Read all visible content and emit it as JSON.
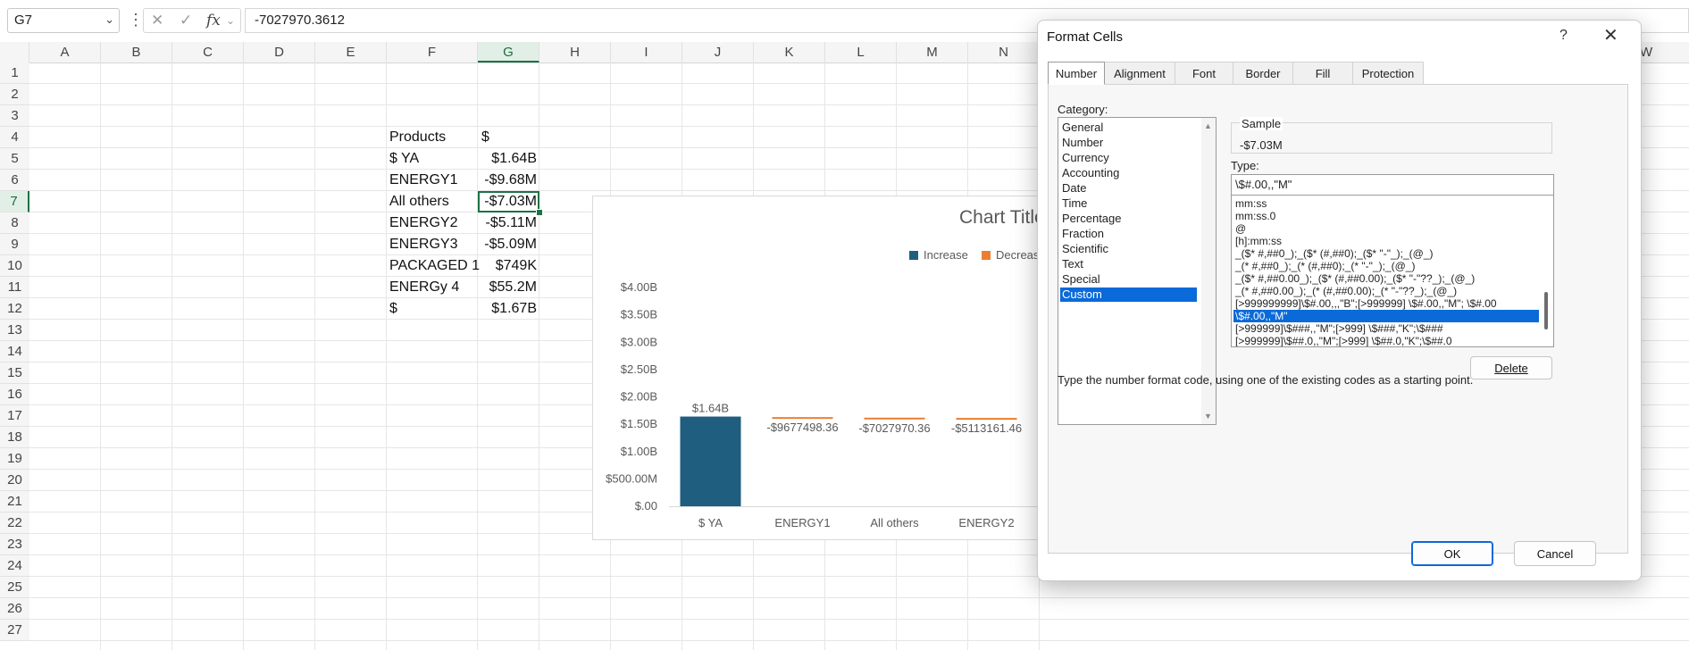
{
  "formula_bar": {
    "name_box": "G7",
    "formula": "-7027970.3612"
  },
  "sheet": {
    "columns": [
      "A",
      "B",
      "C",
      "D",
      "E",
      "F",
      "G",
      "H",
      "I",
      "J",
      "K",
      "L",
      "M",
      "N"
    ],
    "right_column": "W",
    "rows": [
      "1",
      "2",
      "3",
      "4",
      "5",
      "6",
      "7",
      "8",
      "9",
      "10",
      "11",
      "12",
      "13",
      "14",
      "15",
      "16",
      "17",
      "18",
      "19",
      "20",
      "21",
      "22",
      "23",
      "24",
      "25",
      "26",
      "27"
    ],
    "selected_column": "G",
    "selected_row": "7",
    "table": [
      {
        "f": "Products",
        "g": "$"
      },
      {
        "f": "$ YA",
        "g": "$1.64B"
      },
      {
        "f": "ENERGY1",
        "g": "-$9.68M"
      },
      {
        "f": "All others",
        "g": "-$7.03M"
      },
      {
        "f": "ENERGY2",
        "g": "-$5.11M"
      },
      {
        "f": "ENERGY3",
        "g": "-$5.09M"
      },
      {
        "f": "PACKAGED 1",
        "g": "$749K"
      },
      {
        "f": "ENERGy 4",
        "g": "$55.2M"
      },
      {
        "f": "$",
        "g": "$1.67B"
      }
    ]
  },
  "chart_data": {
    "type": "bar",
    "title": "Chart Title",
    "legend": [
      {
        "name": "Increase",
        "color": "#1f5e7f"
      },
      {
        "name": "Decrease",
        "color": "#ed7d31"
      }
    ],
    "legend_visible_text": [
      "Increase",
      "Decreas"
    ],
    "categories": [
      "$ YA",
      "ENERGY1",
      "All others",
      "ENERGY2"
    ],
    "series": [
      {
        "name": "Increase",
        "values": [
          1640000000,
          0,
          0,
          0
        ]
      },
      {
        "name": "Decrease",
        "values": [
          0,
          -9677498.36,
          -7027970.36,
          -5113161.46
        ]
      }
    ],
    "data_labels": [
      "$1.64B",
      "-$9677498.36",
      "-$7027970.36",
      "-$5113161.46"
    ],
    "bar_base": [
      0,
      1630000000,
      1620000000,
      1615000000
    ],
    "yticks": [
      "$.00",
      "$500.00M",
      "$1.00B",
      "$1.50B",
      "$2.00B",
      "$2.50B",
      "$3.00B",
      "$3.50B",
      "$4.00B"
    ],
    "ylim": [
      0,
      4000000000
    ],
    "legend_position": "top",
    "grid": false
  },
  "dialog": {
    "title": "Format Cells",
    "help": "?",
    "close": "✕",
    "tabs": [
      "Number",
      "Alignment",
      "Font",
      "Border",
      "Fill",
      "Protection"
    ],
    "active_tab": "Number",
    "category_label": "Category:",
    "categories": [
      "General",
      "Number",
      "Currency",
      "Accounting",
      "Date",
      "Time",
      "Percentage",
      "Fraction",
      "Scientific",
      "Text",
      "Special",
      "Custom"
    ],
    "selected_category": "Custom",
    "sample_label": "Sample",
    "sample_value": "-$7.03M",
    "type_label": "Type:",
    "type_value": "\\$#.00,,\"M\"",
    "format_codes": [
      "mm:ss",
      "mm:ss.0",
      "@",
      "[h]:mm:ss",
      "_($* #,##0_);_($* (#,##0);_($* \"-\"_);_(@_)",
      "_(* #,##0_);_(* (#,##0);_(* \"-\"_);_(@_)",
      "_($* #,##0.00_);_($* (#,##0.00);_($* \"-\"??_);_(@_)",
      "_(* #,##0.00_);_(* (#,##0.00);_(* \"-\"??_);_(@_)",
      "[>999999999]\\$#.00,,,\"B\";[>999999] \\$#.00,,\"M\"; \\$#.00",
      "\\$#.00,,\"M\"",
      "[>999999]\\$###,,\"M\";[>999] \\$###,\"K\";\\$###",
      "[>999999]\\$##.0,,\"M\";[>999] \\$##.0,\"K\";\\$##.0"
    ],
    "selected_format_index": 9,
    "delete_label": "Delete",
    "hint": "Type the number format code, using one of the existing codes as a starting point.",
    "ok_label": "OK",
    "cancel_label": "Cancel"
  },
  "colors": {
    "excel_green": "#1e7145",
    "selection_blue": "#0a6ad9",
    "increase": "#1f5e7f",
    "decrease": "#ed7d31"
  }
}
